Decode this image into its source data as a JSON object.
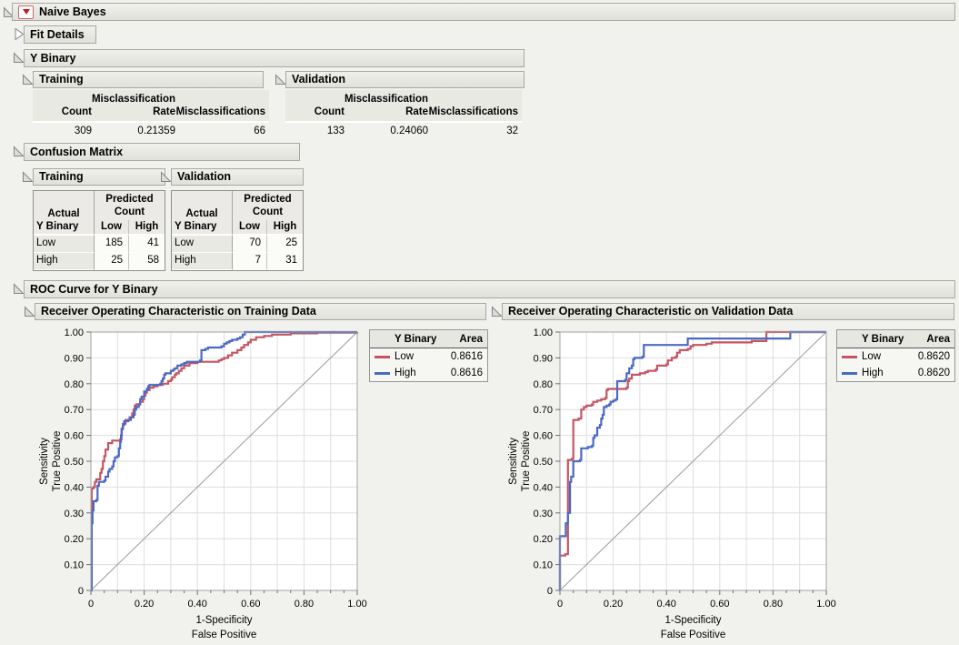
{
  "app": {
    "title": "Naive Bayes"
  },
  "fit_details": {
    "label": "Fit Details"
  },
  "y_binary": {
    "label": "Y Binary",
    "panels": [
      {
        "label": "Training",
        "headers": [
          "Count",
          "Misclassification\nRate",
          "Misclassifications"
        ],
        "values": [
          "309",
          "0.21359",
          "66"
        ]
      },
      {
        "label": "Validation",
        "headers": [
          "Count",
          "Misclassification\nRate",
          "Misclassifications"
        ],
        "values": [
          "133",
          "0.24060",
          "32"
        ]
      }
    ]
  },
  "confusion_matrix": {
    "label": "Confusion Matrix",
    "panels": [
      {
        "label": "Training",
        "corner_top": "Actual",
        "corner_bottom": "Y Binary",
        "col_group": "Predicted\nCount",
        "col_labels": [
          "Low",
          "High"
        ],
        "rows": [
          {
            "label": "Low",
            "values": [
              "185",
              "41"
            ]
          },
          {
            "label": "High",
            "values": [
              "25",
              "58"
            ]
          }
        ]
      },
      {
        "label": "Validation",
        "corner_top": "Actual",
        "corner_bottom": "Y Binary",
        "col_group": "Predicted\nCount",
        "col_labels": [
          "Low",
          "High"
        ],
        "rows": [
          {
            "label": "Low",
            "values": [
              "70",
              "25"
            ]
          },
          {
            "label": "High",
            "values": [
              "7",
              "31"
            ]
          }
        ]
      }
    ]
  },
  "roc_section": {
    "label": "ROC Curve for Y Binary"
  },
  "colors": {
    "curve_low": "#C45562",
    "curve_high": "#4A69C4",
    "grid": "#dedede",
    "diagonal": "#9a9a9a",
    "header_bar_bg": "#e8e8e3",
    "page_bg": "#f1f1ed",
    "red_triangle": "#c41f1f"
  },
  "chart_data": [
    {
      "type": "line",
      "title": "Receiver Operating Characteristic on Training Data",
      "xlabel_lines": [
        "1-Specificity",
        "False Positive"
      ],
      "ylabel_lines": [
        "Sensitivity",
        "True Positive"
      ],
      "xlim": [
        0,
        1
      ],
      "ylim": [
        0,
        1
      ],
      "x_major_tick_step": 0.2,
      "x_minor_tick_step": 0.05,
      "y_tick_step": 0.1,
      "grid": true,
      "grid_step": 0.1,
      "diagonal_reference_line": true,
      "legend": {
        "columns": [
          "Y Binary",
          "Area"
        ],
        "entries": [
          {
            "label": "Low",
            "area": "0.8616",
            "color": "#C45562"
          },
          {
            "label": "High",
            "area": "0.8616",
            "color": "#4A69C4"
          }
        ]
      },
      "series": [
        {
          "name": "Low",
          "color": "#C45562",
          "points": [
            [
              0,
              0
            ],
            [
              0.003,
              0.395
            ],
            [
              0.01,
              0.4
            ],
            [
              0.015,
              0.42
            ],
            [
              0.02,
              0.43
            ],
            [
              0.035,
              0.455
            ],
            [
              0.04,
              0.47
            ],
            [
              0.045,
              0.5
            ],
            [
              0.05,
              0.52
            ],
            [
              0.055,
              0.545
            ],
            [
              0.065,
              0.57
            ],
            [
              0.08,
              0.58
            ],
            [
              0.11,
              0.585
            ],
            [
              0.115,
              0.625
            ],
            [
              0.12,
              0.645
            ],
            [
              0.13,
              0.66
            ],
            [
              0.145,
              0.67
            ],
            [
              0.155,
              0.685
            ],
            [
              0.16,
              0.7
            ],
            [
              0.165,
              0.715
            ],
            [
              0.17,
              0.72
            ],
            [
              0.185,
              0.73
            ],
            [
              0.195,
              0.74
            ],
            [
              0.2,
              0.755
            ],
            [
              0.205,
              0.765
            ],
            [
              0.21,
              0.775
            ],
            [
              0.22,
              0.785
            ],
            [
              0.235,
              0.79
            ],
            [
              0.25,
              0.795
            ],
            [
              0.27,
              0.8
            ],
            [
              0.29,
              0.81
            ],
            [
              0.3,
              0.815
            ],
            [
              0.305,
              0.825
            ],
            [
              0.315,
              0.835
            ],
            [
              0.32,
              0.84
            ],
            [
              0.33,
              0.85
            ],
            [
              0.34,
              0.86
            ],
            [
              0.35,
              0.87
            ],
            [
              0.37,
              0.88
            ],
            [
              0.4,
              0.885
            ],
            [
              0.48,
              0.89
            ],
            [
              0.49,
              0.895
            ],
            [
              0.5,
              0.9
            ],
            [
              0.515,
              0.91
            ],
            [
              0.53,
              0.92
            ],
            [
              0.55,
              0.93
            ],
            [
              0.565,
              0.94
            ],
            [
              0.575,
              0.95
            ],
            [
              0.59,
              0.96
            ],
            [
              0.6,
              0.97
            ],
            [
              0.62,
              0.98
            ],
            [
              0.65,
              0.985
            ],
            [
              0.68,
              0.99
            ],
            [
              0.75,
              0.995
            ],
            [
              0.85,
              0.998
            ],
            [
              1,
              1
            ]
          ]
        },
        {
          "name": "High",
          "color": "#4A69C4",
          "points": [
            [
              0,
              0
            ],
            [
              0.003,
              0.26
            ],
            [
              0.006,
              0.31
            ],
            [
              0.01,
              0.345
            ],
            [
              0.02,
              0.35
            ],
            [
              0.025,
              0.405
            ],
            [
              0.03,
              0.42
            ],
            [
              0.05,
              0.425
            ],
            [
              0.055,
              0.44
            ],
            [
              0.065,
              0.46
            ],
            [
              0.07,
              0.47
            ],
            [
              0.08,
              0.48
            ],
            [
              0.085,
              0.5
            ],
            [
              0.09,
              0.515
            ],
            [
              0.1,
              0.52
            ],
            [
              0.105,
              0.55
            ],
            [
              0.11,
              0.575
            ],
            [
              0.113,
              0.6
            ],
            [
              0.116,
              0.625
            ],
            [
              0.12,
              0.64
            ],
            [
              0.125,
              0.655
            ],
            [
              0.14,
              0.66
            ],
            [
              0.15,
              0.67
            ],
            [
              0.16,
              0.68
            ],
            [
              0.165,
              0.7
            ],
            [
              0.17,
              0.71
            ],
            [
              0.18,
              0.72
            ],
            [
              0.185,
              0.74
            ],
            [
              0.19,
              0.75
            ],
            [
              0.2,
              0.77
            ],
            [
              0.21,
              0.78
            ],
            [
              0.215,
              0.79
            ],
            [
              0.22,
              0.795
            ],
            [
              0.26,
              0.8
            ],
            [
              0.265,
              0.81
            ],
            [
              0.27,
              0.82
            ],
            [
              0.275,
              0.835
            ],
            [
              0.28,
              0.84
            ],
            [
              0.3,
              0.85
            ],
            [
              0.31,
              0.855
            ],
            [
              0.315,
              0.86
            ],
            [
              0.325,
              0.87
            ],
            [
              0.34,
              0.875
            ],
            [
              0.35,
              0.88
            ],
            [
              0.36,
              0.885
            ],
            [
              0.41,
              0.89
            ],
            [
              0.415,
              0.93
            ],
            [
              0.43,
              0.935
            ],
            [
              0.44,
              0.94
            ],
            [
              0.49,
              0.945
            ],
            [
              0.5,
              0.955
            ],
            [
              0.51,
              0.96
            ],
            [
              0.52,
              0.965
            ],
            [
              0.53,
              0.97
            ],
            [
              0.55,
              0.975
            ],
            [
              0.56,
              0.98
            ],
            [
              0.57,
              0.99
            ],
            [
              0.578,
              1
            ],
            [
              1,
              1
            ]
          ]
        }
      ]
    },
    {
      "type": "line",
      "title": "Receiver Operating Characteristic on Validation Data",
      "xlabel_lines": [
        "1-Specificity",
        "False Positive"
      ],
      "ylabel_lines": [
        "Sensitivity",
        "True Positive"
      ],
      "xlim": [
        0,
        1
      ],
      "ylim": [
        0,
        1
      ],
      "x_major_tick_step": 0.2,
      "x_minor_tick_step": 0.05,
      "y_tick_step": 0.1,
      "grid": true,
      "grid_step": 0.1,
      "diagonal_reference_line": true,
      "legend": {
        "columns": [
          "Y Binary",
          "Area"
        ],
        "entries": [
          {
            "label": "Low",
            "area": "0.8620",
            "color": "#C45562"
          },
          {
            "label": "High",
            "area": "0.8620",
            "color": "#4A69C4"
          }
        ]
      },
      "series": [
        {
          "name": "Low",
          "color": "#C45562",
          "points": [
            [
              0,
              0
            ],
            [
              0,
              0.135
            ],
            [
              0.02,
              0.135
            ],
            [
              0.02,
              0.14
            ],
            [
              0.03,
              0.14
            ],
            [
              0.03,
              0.505
            ],
            [
              0.045,
              0.51
            ],
            [
              0.05,
              0.66
            ],
            [
              0.07,
              0.665
            ],
            [
              0.08,
              0.7
            ],
            [
              0.09,
              0.71
            ],
            [
              0.1,
              0.715
            ],
            [
              0.12,
              0.72
            ],
            [
              0.125,
              0.73
            ],
            [
              0.14,
              0.735
            ],
            [
              0.155,
              0.74
            ],
            [
              0.17,
              0.745
            ],
            [
              0.175,
              0.775
            ],
            [
              0.18,
              0.78
            ],
            [
              0.25,
              0.785
            ],
            [
              0.255,
              0.81
            ],
            [
              0.26,
              0.82
            ],
            [
              0.27,
              0.835
            ],
            [
              0.3,
              0.84
            ],
            [
              0.32,
              0.845
            ],
            [
              0.33,
              0.85
            ],
            [
              0.36,
              0.855
            ],
            [
              0.365,
              0.87
            ],
            [
              0.4,
              0.875
            ],
            [
              0.405,
              0.89
            ],
            [
              0.42,
              0.9
            ],
            [
              0.435,
              0.905
            ],
            [
              0.44,
              0.92
            ],
            [
              0.45,
              0.93
            ],
            [
              0.48,
              0.935
            ],
            [
              0.49,
              0.945
            ],
            [
              0.5,
              0.95
            ],
            [
              0.55,
              0.955
            ],
            [
              0.57,
              0.96
            ],
            [
              0.7,
              0.96
            ],
            [
              0.72,
              0.965
            ],
            [
              0.775,
              0.97
            ],
            [
              0.775,
              1
            ],
            [
              1,
              1
            ]
          ]
        },
        {
          "name": "High",
          "color": "#4A69C4",
          "points": [
            [
              0,
              0
            ],
            [
              0,
              0.21
            ],
            [
              0.022,
              0.21
            ],
            [
              0.022,
              0.26
            ],
            [
              0.03,
              0.26
            ],
            [
              0.03,
              0.3
            ],
            [
              0.038,
              0.3
            ],
            [
              0.038,
              0.42
            ],
            [
              0.042,
              0.44
            ],
            [
              0.05,
              0.5
            ],
            [
              0.075,
              0.505
            ],
            [
              0.08,
              0.55
            ],
            [
              0.105,
              0.555
            ],
            [
              0.12,
              0.56
            ],
            [
              0.125,
              0.59
            ],
            [
              0.13,
              0.6
            ],
            [
              0.14,
              0.63
            ],
            [
              0.15,
              0.64
            ],
            [
              0.155,
              0.665
            ],
            [
              0.16,
              0.68
            ],
            [
              0.165,
              0.71
            ],
            [
              0.175,
              0.715
            ],
            [
              0.185,
              0.72
            ],
            [
              0.19,
              0.73
            ],
            [
              0.2,
              0.735
            ],
            [
              0.21,
              0.74
            ],
            [
              0.215,
              0.81
            ],
            [
              0.245,
              0.815
            ],
            [
              0.25,
              0.84
            ],
            [
              0.26,
              0.86
            ],
            [
              0.27,
              0.87
            ],
            [
              0.275,
              0.895
            ],
            [
              0.28,
              0.9
            ],
            [
              0.31,
              0.905
            ],
            [
              0.315,
              0.95
            ],
            [
              0.47,
              0.95
            ],
            [
              0.48,
              0.975
            ],
            [
              0.86,
              0.975
            ],
            [
              0.865,
              1
            ],
            [
              1,
              1
            ]
          ]
        }
      ]
    }
  ]
}
